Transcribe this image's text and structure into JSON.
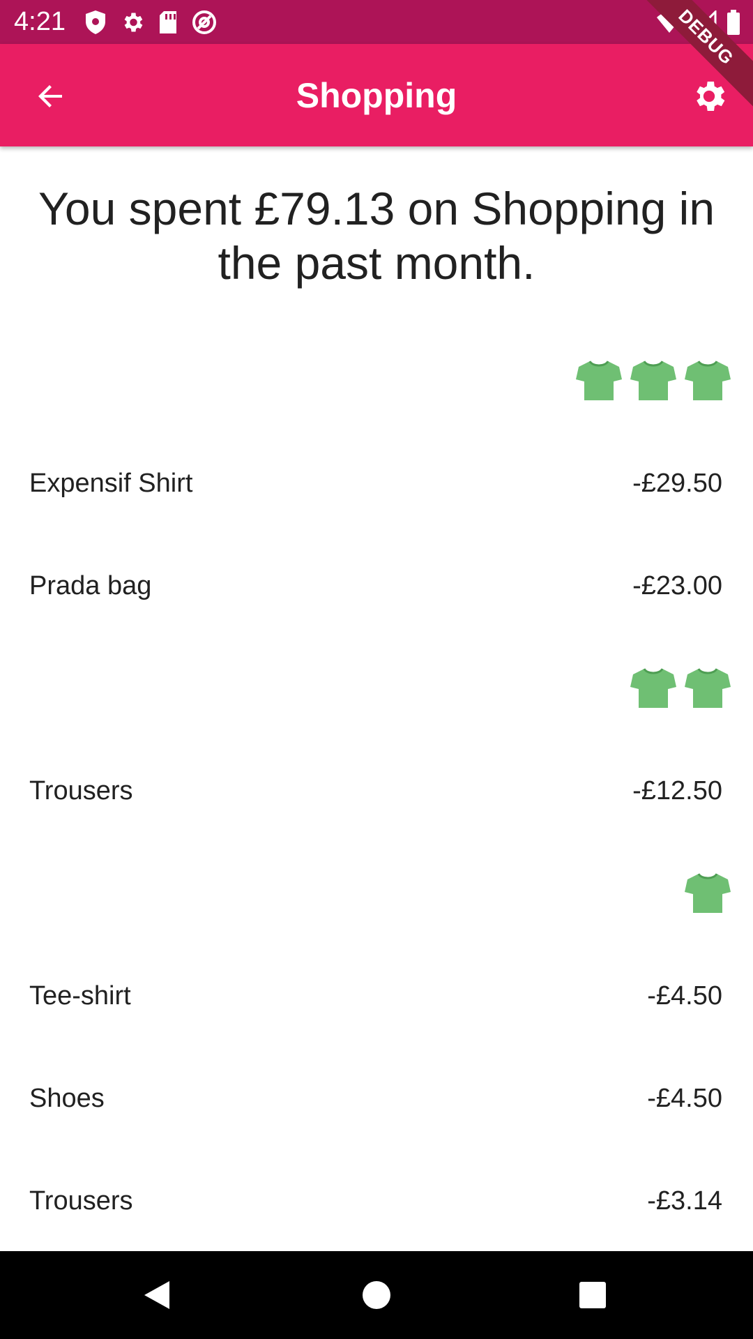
{
  "status_bar": {
    "time": "4:21",
    "left_icons": [
      "shield-icon",
      "gear-icon",
      "sd-card-icon",
      "at-sign-icon"
    ],
    "right_icons": [
      "wifi-icon",
      "signal-icon",
      "battery-icon"
    ]
  },
  "app_bar": {
    "title": "Shopping",
    "back_icon": "arrow-left-icon",
    "settings_icon": "gear-icon",
    "color": "#e91e63",
    "status_color": "#ad1457"
  },
  "debug_banner": "DEBUG",
  "summary": "You spent £79.13 on Shopping in the past month.",
  "shirt_color": "#6fbf73",
  "groups": [
    {
      "shirts": 3
    },
    {
      "label": "Expensif Shirt",
      "amount": "-£29.50"
    },
    {
      "label": "Prada bag",
      "amount": "-£23.00"
    },
    {
      "shirts": 2
    },
    {
      "label": "Trousers",
      "amount": "-£12.50"
    },
    {
      "shirts": 1
    },
    {
      "label": "Tee-shirt",
      "amount": "-£4.50"
    },
    {
      "label": "Shoes",
      "amount": "-£4.50"
    },
    {
      "label": "Trousers",
      "amount": "-£3.14"
    }
  ],
  "transactions": [
    {
      "label": "Expensif Shirt",
      "amount": "-£29.50"
    },
    {
      "label": "Prada bag",
      "amount": "-£23.00"
    },
    {
      "label": "Trousers",
      "amount": "-£12.50"
    },
    {
      "label": "Tee-shirt",
      "amount": "-£4.50"
    },
    {
      "label": "Shoes",
      "amount": "-£4.50"
    },
    {
      "label": "Trousers",
      "amount": "-£3.14"
    }
  ],
  "nav_bar": {
    "buttons": [
      "back-triangle-icon",
      "home-circle-icon",
      "recents-square-icon"
    ]
  }
}
